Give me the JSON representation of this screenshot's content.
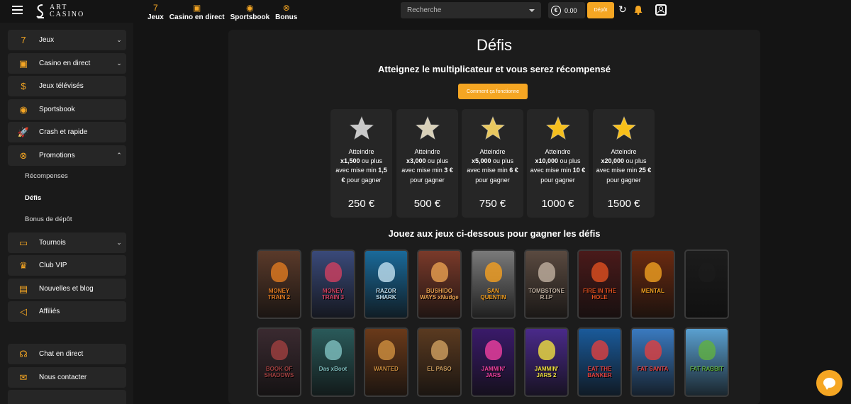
{
  "brand": {
    "line1": "ART",
    "line2": "CASINO"
  },
  "topnav": [
    {
      "icon": "7",
      "label": "Jeux"
    },
    {
      "icon": "▣",
      "label": "Casino en direct"
    },
    {
      "icon": "◉",
      "label": "Sportsbook"
    },
    {
      "icon": "⊗",
      "label": "Bonus"
    }
  ],
  "search": {
    "placeholder": "Recherche"
  },
  "wallet": {
    "currency_icon": "€",
    "balance": "0.00"
  },
  "deposit_label": "Dépôt",
  "sidebar": {
    "items": [
      {
        "icon": "7",
        "label": "Jeux",
        "chevron": "⌄"
      },
      {
        "icon": "▣",
        "label": "Casino en direct",
        "chevron": "⌄"
      },
      {
        "icon": "$",
        "label": "Jeux télévisés"
      },
      {
        "icon": "◉",
        "label": "Sportsbook"
      },
      {
        "icon": "🚀",
        "label": "Crash et rapide"
      },
      {
        "icon": "⊗",
        "label": "Promotions",
        "chevron": "⌃"
      },
      {
        "icon": "▭",
        "label": "Tournois",
        "chevron": "⌄"
      },
      {
        "icon": "♛",
        "label": "Club VIP"
      },
      {
        "icon": "▤",
        "label": "Nouvelles et blog"
      },
      {
        "icon": "◁",
        "label": "Affiliés"
      },
      {
        "icon": "☊",
        "label": "Chat en direct"
      },
      {
        "icon": "✉",
        "label": "Nous contacter"
      }
    ],
    "sub_items": [
      {
        "label": "Récompenses"
      },
      {
        "label": "Défis"
      },
      {
        "label": "Bonus de dépôt"
      }
    ]
  },
  "page": {
    "title": "Défis",
    "subtitle": "Atteignez le multiplicateur et vous serez récompensé",
    "how_button": "Comment ça fonctionne",
    "games_title": "Jouez aux jeux ci-dessous pour gagner les défis"
  },
  "challenges": [
    {
      "reach": "Atteindre",
      "mult": "x1,500",
      "mid": "ou plus avec mise min",
      "stake": "1,5 €",
      "tail": "pour gagner",
      "reward": "250 €",
      "star_color": "#c8c8c8"
    },
    {
      "reach": "Atteindre",
      "mult": "x3,000",
      "mid": "ou plus avec mise min",
      "stake": "3 €",
      "tail": "pour gagner",
      "reward": "500 €",
      "star_color": "#d8d0b8"
    },
    {
      "reach": "Atteindre",
      "mult": "x5,000",
      "mid": "ou plus avec mise min",
      "stake": "6 €",
      "tail": "pour gagner",
      "reward": "750 €",
      "star_color": "#e8c860"
    },
    {
      "reach": "Atteindre",
      "mult": "x10,000",
      "mid": "ou plus avec mise min",
      "stake": "10 €",
      "tail": "pour gagner",
      "reward": "1000 €",
      "star_color": "#f5bf1e"
    },
    {
      "reach": "Atteindre",
      "mult": "x20,000",
      "mid": "ou plus avec mise min",
      "stake": "25 €",
      "tail": "pour gagner",
      "reward": "1500 €",
      "star_color": "#f8c01a"
    }
  ],
  "games_row1": [
    {
      "name": "MONEY TRAIN 2",
      "bg": "#5a3a2a",
      "accent": "#e07a20"
    },
    {
      "name": "MONEY TRAIN 3",
      "bg": "#3a4a7a",
      "accent": "#d04060"
    },
    {
      "name": "RAZOR SHARK",
      "bg": "#1a6a9a",
      "accent": "#c0e0f0"
    },
    {
      "name": "BUSHIDO WAYS xNudge",
      "bg": "#7a3a2a",
      "accent": "#e8a050"
    },
    {
      "name": "SAN QUENTIN",
      "bg": "#7a7a7a",
      "accent": "#f5a020"
    },
    {
      "name": "TOMBSTONE R.I.P",
      "bg": "#5a4a40",
      "accent": "#c0b0a0"
    },
    {
      "name": "FIRE IN THE HOLE",
      "bg": "#4a1a1a",
      "accent": "#e05020"
    },
    {
      "name": "MENTAL",
      "bg": "#6a2a10",
      "accent": "#f0a020"
    },
    {
      "name": "",
      "bg": "#1c1c1c",
      "accent": "#1c1c1c"
    }
  ],
  "games_row2": [
    {
      "name": "BOOK OF SHADOWS",
      "bg": "#3a2a30",
      "accent": "#a04040"
    },
    {
      "name": "Das xBoot",
      "bg": "#2a5a5a",
      "accent": "#80c0c0"
    },
    {
      "name": "WANTED",
      "bg": "#6a3a1a",
      "accent": "#d09040"
    },
    {
      "name": "EL PASO",
      "bg": "#5a3a20",
      "accent": "#d0a060"
    },
    {
      "name": "JAMMIN' JARS",
      "bg": "#3a1a6a",
      "accent": "#f040a0"
    },
    {
      "name": "JAMMIN' JARS 2",
      "bg": "#4a2a8a",
      "accent": "#f0e040"
    },
    {
      "name": "EAT THE BANKER",
      "bg": "#1a5a9a",
      "accent": "#e04040"
    },
    {
      "name": "FAT SANTA",
      "bg": "#3a7ac0",
      "accent": "#e04040"
    },
    {
      "name": "FAT RABBIT",
      "bg": "#5aa0d0",
      "accent": "#60b040"
    }
  ],
  "colors": {
    "accent": "#f5a623",
    "panel": "#1c1c1c",
    "card": "#262626",
    "sidebar": "#1a1a1a"
  }
}
